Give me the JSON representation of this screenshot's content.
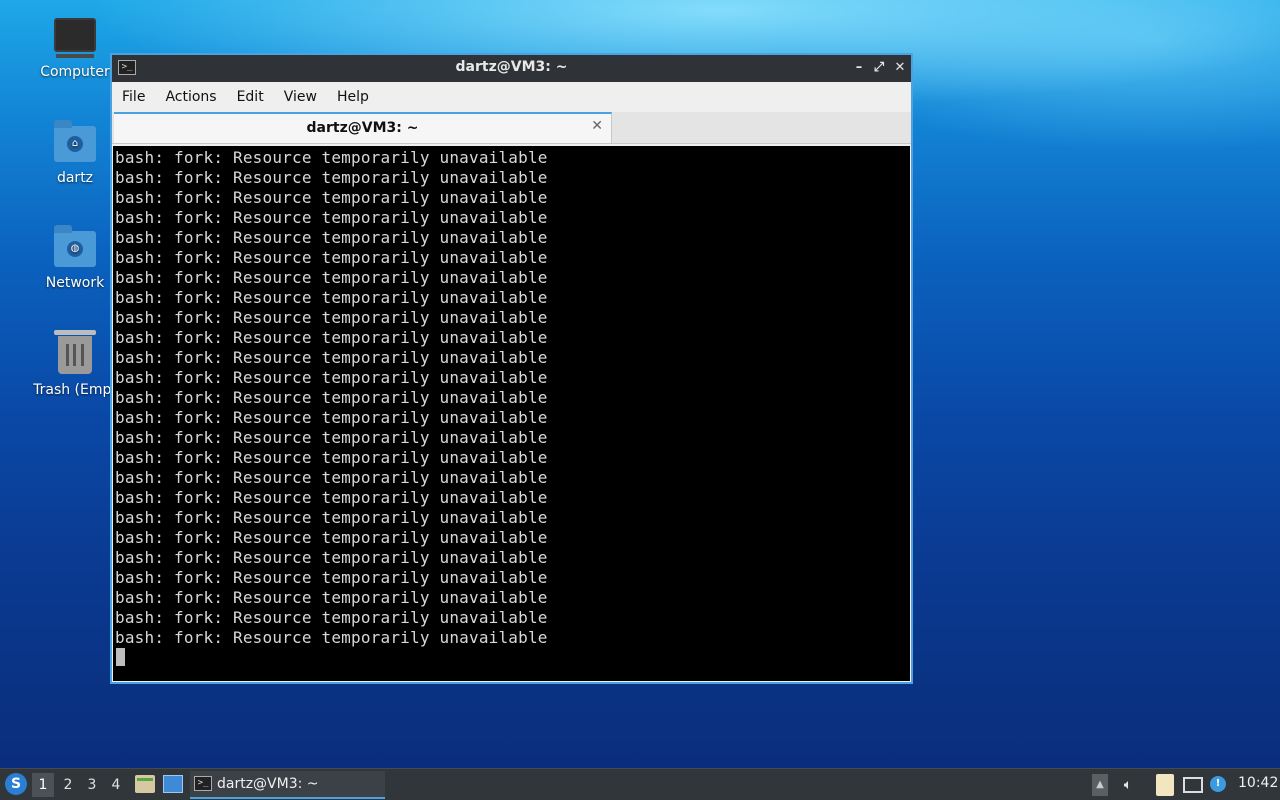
{
  "desktop": {
    "icons": [
      {
        "label": "Computer",
        "icon": "computer-icon"
      },
      {
        "label": "dartz",
        "icon": "home-folder-icon"
      },
      {
        "label": "Network",
        "icon": "network-folder-icon"
      },
      {
        "label": "Trash (Empt",
        "icon": "trash-icon"
      }
    ]
  },
  "window": {
    "title": "dartz@VM3: ~",
    "controls": {
      "minimize": "–",
      "maximize": "⤢",
      "close": "✕"
    },
    "menu": [
      "File",
      "Actions",
      "Edit",
      "View",
      "Help"
    ],
    "tab": {
      "label": "dartz@VM3: ~",
      "close": "✕"
    },
    "terminal_lines": [
      "bash: fork: Resource temporarily unavailable",
      "bash: fork: Resource temporarily unavailable",
      "bash: fork: Resource temporarily unavailable",
      "bash: fork: Resource temporarily unavailable",
      "bash: fork: Resource temporarily unavailable",
      "bash: fork: Resource temporarily unavailable",
      "bash: fork: Resource temporarily unavailable",
      "bash: fork: Resource temporarily unavailable",
      "bash: fork: Resource temporarily unavailable",
      "bash: fork: Resource temporarily unavailable",
      "bash: fork: Resource temporarily unavailable",
      "bash: fork: Resource temporarily unavailable",
      "bash: fork: Resource temporarily unavailable",
      "bash: fork: Resource temporarily unavailable",
      "bash: fork: Resource temporarily unavailable",
      "bash: fork: Resource temporarily unavailable",
      "bash: fork: Resource temporarily unavailable",
      "bash: fork: Resource temporarily unavailable",
      "bash: fork: Resource temporarily unavailable",
      "bash: fork: Resource temporarily unavailable",
      "bash: fork: Resource temporarily unavailable",
      "bash: fork: Resource temporarily unavailable",
      "bash: fork: Resource temporarily unavailable",
      "bash: fork: Resource temporarily unavailable",
      "bash: fork: Resource temporarily unavailable"
    ],
    "colors": {
      "terminal_bg": "#000000",
      "terminal_fg": "#d8d8d8",
      "accent": "#4aa3e0"
    }
  },
  "taskbar": {
    "workspaces": [
      "1",
      "2",
      "3",
      "4"
    ],
    "active_workspace": "1",
    "task_label": "dartz@VM3: ~",
    "clock": "10:42"
  }
}
